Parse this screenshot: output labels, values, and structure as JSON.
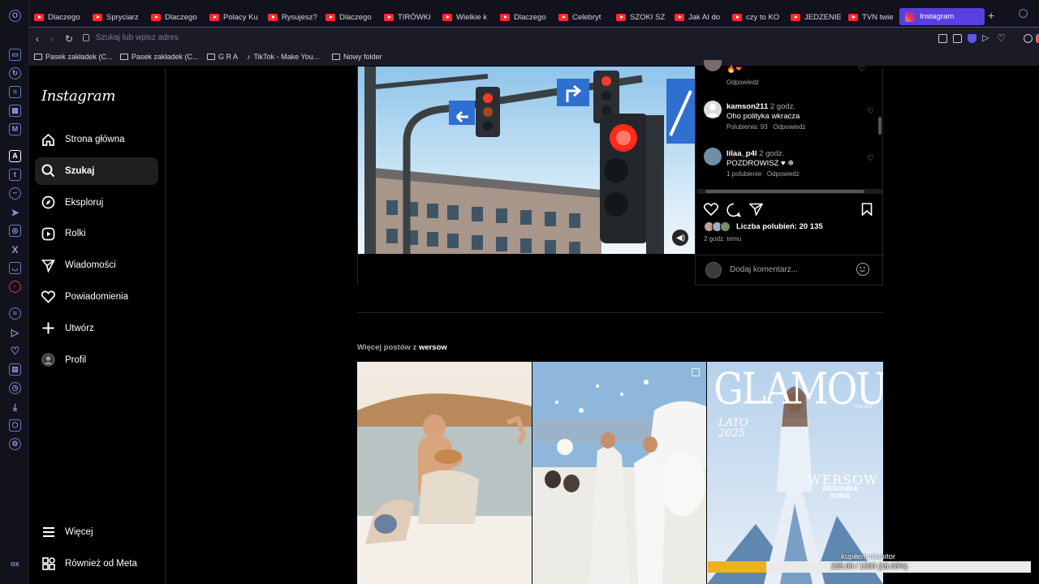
{
  "browser": {
    "tabs": [
      {
        "label": "Dlaczego",
        "icon": "youtube-icon"
      },
      {
        "label": "Spryciarz",
        "icon": "youtube-icon"
      },
      {
        "label": "Dlaczego",
        "icon": "youtube-icon"
      },
      {
        "label": "Polacy Ku",
        "icon": "youtube-icon"
      },
      {
        "label": "Rysujesz?",
        "icon": "youtube-icon"
      },
      {
        "label": "Dlaczego",
        "icon": "youtube-icon"
      },
      {
        "label": "TIRÓWKI",
        "icon": "youtube-icon"
      },
      {
        "label": "Wielkie k",
        "icon": "youtube-icon"
      },
      {
        "label": "Dlaczego",
        "icon": "youtube-icon"
      },
      {
        "label": "Celebryt",
        "icon": "youtube-icon"
      },
      {
        "label": "SZOKI SZ",
        "icon": "youtube-icon"
      },
      {
        "label": "Jak AI do",
        "icon": "youtube-icon"
      },
      {
        "label": "czy to KO",
        "icon": "youtube-icon"
      },
      {
        "label": "JEDZENIE",
        "icon": "youtube-icon"
      },
      {
        "label": "TVN twie",
        "icon": "youtube-icon"
      }
    ],
    "active_tab": "Instagram",
    "address_placeholder": "Szukaj lub wpisz adres",
    "bookmarks": [
      {
        "label": "Pasek zakładek (C...",
        "icon": "folder-icon"
      },
      {
        "label": "Pasek zakładek (C...",
        "icon": "folder-icon"
      },
      {
        "label": "G R A",
        "icon": "folder-icon"
      },
      {
        "label": "TikTok - Make You...",
        "icon": "tiktok-icon"
      },
      {
        "label": "Nowy folder",
        "icon": "folder-icon"
      }
    ]
  },
  "instagram": {
    "logo": "Instagram",
    "nav": [
      {
        "label": "Strona główna",
        "icon": "home-icon"
      },
      {
        "label": "Szukaj",
        "icon": "search-icon",
        "selected": true
      },
      {
        "label": "Eksploruj",
        "icon": "compass-icon"
      },
      {
        "label": "Rolki",
        "icon": "reels-icon"
      },
      {
        "label": "Wiadomości",
        "icon": "send-icon"
      },
      {
        "label": "Powiadomienia",
        "icon": "heart-icon"
      },
      {
        "label": "Utwórz",
        "icon": "plus-icon"
      },
      {
        "label": "Profil",
        "icon": "avatar-icon"
      }
    ],
    "more": "Więcej",
    "meta": "Również od Meta"
  },
  "post": {
    "top_comment_reply": "Odpowiedz",
    "comments": [
      {
        "user": "kamson211",
        "time": "2 godz.",
        "text": "Oho polityka wkracza",
        "likes": "Polubienia: 93",
        "reply": "Odpowiedz"
      },
      {
        "user": "lilaa_p4l",
        "time": "2 godz.",
        "text": "POZDROWISZ ♥ ❄",
        "likes": "1 polubienie",
        "reply": "Odpowiedz"
      }
    ],
    "likes_text": "Liczba polubień: 20 135",
    "time": "2 godz. temu",
    "add_comment_placeholder": "Dodaj komentarz..."
  },
  "more_posts": {
    "prefix": "Więcej postów z",
    "user": "wersow"
  },
  "glamour": {
    "title": "GLAMOUR",
    "subtitle": "POLSKA",
    "issue": "LATO 2025",
    "name1": "WERSOW",
    "name2": "WERONIKA SOWA"
  },
  "overlay": {
    "title": "kupiłem monitor",
    "progress_text": "235.00 / 1300 (18.08%)",
    "progress_fraction": 0.1808
  },
  "colors": {
    "accent": "#5a3fe0",
    "progress": "#f0b020"
  }
}
